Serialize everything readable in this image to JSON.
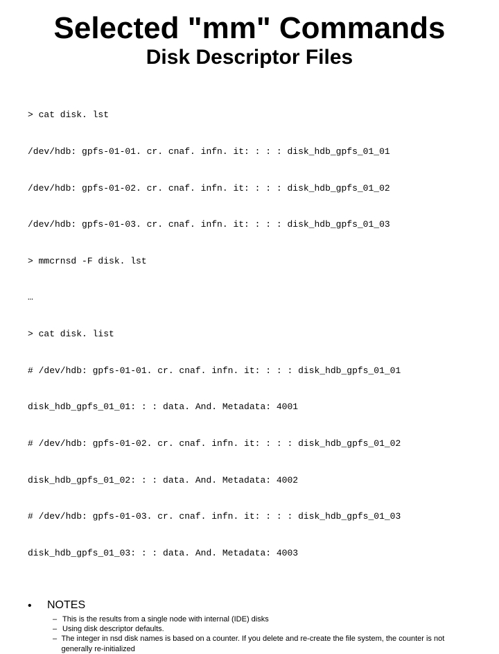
{
  "title": "Selected \"mm\" Commands",
  "subtitle": "Disk Descriptor Files",
  "code_lines": [
    "> cat disk. lst",
    "/dev/hdb: gpfs-01-01. cr. cnaf. infn. it: : : : disk_hdb_gpfs_01_01",
    "/dev/hdb: gpfs-01-02. cr. cnaf. infn. it: : : : disk_hdb_gpfs_01_02",
    "/dev/hdb: gpfs-01-03. cr. cnaf. infn. it: : : : disk_hdb_gpfs_01_03",
    "> mmcrnsd -F disk. lst",
    "…",
    "> cat disk. list",
    "# /dev/hdb: gpfs-01-01. cr. cnaf. infn. it: : : : disk_hdb_gpfs_01_01",
    "disk_hdb_gpfs_01_01: : : data. And. Metadata: 4001",
    "# /dev/hdb: gpfs-01-02. cr. cnaf. infn. it: : : : disk_hdb_gpfs_01_02",
    "disk_hdb_gpfs_01_02: : : data. And. Metadata: 4002",
    "# /dev/hdb: gpfs-01-03. cr. cnaf. infn. it: : : : disk_hdb_gpfs_01_03",
    "disk_hdb_gpfs_01_03: : : data. And. Metadata: 4003"
  ],
  "notes": {
    "bullet_glyph": "•",
    "heading": "NOTES",
    "dash_glyph": "–",
    "items": [
      "This is the results from a single node with internal (IDE) disks",
      "Using disk descriptor defaults.",
      "The integer in nsd disk names is based on a counter. If you delete and re-create the file system, the counter is not generally re-initialized"
    ]
  }
}
